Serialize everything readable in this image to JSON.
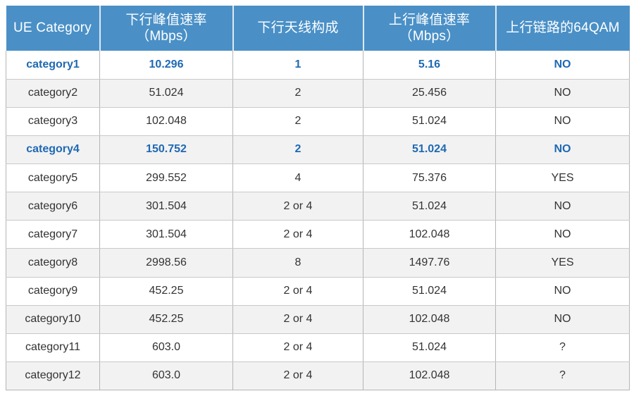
{
  "table": {
    "columns": [
      {
        "id": "ue_category",
        "lines": [
          "UE Category"
        ]
      },
      {
        "id": "dl_peak_rate",
        "lines": [
          "下行峰值速率",
          "（Mbps）"
        ]
      },
      {
        "id": "dl_antenna",
        "lines": [
          "下行天线构成"
        ]
      },
      {
        "id": "ul_peak_rate",
        "lines": [
          "上行峰值速率",
          "（Mbps）"
        ]
      },
      {
        "id": "ul_64qam",
        "lines": [
          "上行链路的64QAM"
        ]
      }
    ],
    "header_bg": "#4a90c7",
    "header_fg": "#ffffff",
    "highlight_color": "#1f69b3",
    "stripe_color": "#f2f2f2",
    "rows": [
      {
        "ue_category": "category1",
        "dl_peak_rate": "10.296",
        "dl_antenna": "1",
        "ul_peak_rate": "5.16",
        "ul_64qam": "NO",
        "highlight": true,
        "stripe": false
      },
      {
        "ue_category": "category2",
        "dl_peak_rate": "51.024",
        "dl_antenna": "2",
        "ul_peak_rate": "25.456",
        "ul_64qam": "NO",
        "highlight": false,
        "stripe": true
      },
      {
        "ue_category": "category3",
        "dl_peak_rate": "102.048",
        "dl_antenna": "2",
        "ul_peak_rate": "51.024",
        "ul_64qam": "NO",
        "highlight": false,
        "stripe": false
      },
      {
        "ue_category": "category4",
        "dl_peak_rate": "150.752",
        "dl_antenna": "2",
        "ul_peak_rate": "51.024",
        "ul_64qam": "NO",
        "highlight": true,
        "stripe": true
      },
      {
        "ue_category": "category5",
        "dl_peak_rate": "299.552",
        "dl_antenna": "4",
        "ul_peak_rate": "75.376",
        "ul_64qam": "YES",
        "highlight": false,
        "stripe": false
      },
      {
        "ue_category": "category6",
        "dl_peak_rate": "301.504",
        "dl_antenna": "2 or 4",
        "ul_peak_rate": "51.024",
        "ul_64qam": "NO",
        "highlight": false,
        "stripe": true
      },
      {
        "ue_category": "category7",
        "dl_peak_rate": "301.504",
        "dl_antenna": "2 or 4",
        "ul_peak_rate": "102.048",
        "ul_64qam": "NO",
        "highlight": false,
        "stripe": false
      },
      {
        "ue_category": "category8",
        "dl_peak_rate": "2998.56",
        "dl_antenna": "8",
        "ul_peak_rate": "1497.76",
        "ul_64qam": "YES",
        "highlight": false,
        "stripe": true
      },
      {
        "ue_category": "category9",
        "dl_peak_rate": "452.25",
        "dl_antenna": "2 or 4",
        "ul_peak_rate": "51.024",
        "ul_64qam": "NO",
        "highlight": false,
        "stripe": false
      },
      {
        "ue_category": "category10",
        "dl_peak_rate": "452.25",
        "dl_antenna": "2 or 4",
        "ul_peak_rate": "102.048",
        "ul_64qam": "NO",
        "highlight": false,
        "stripe": true
      },
      {
        "ue_category": "category11",
        "dl_peak_rate": "603.0",
        "dl_antenna": "2 or 4",
        "ul_peak_rate": "51.024",
        "ul_64qam": "?",
        "highlight": false,
        "stripe": false
      },
      {
        "ue_category": "category12",
        "dl_peak_rate": "603.0",
        "dl_antenna": "2 or 4",
        "ul_peak_rate": "102.048",
        "ul_64qam": "?",
        "highlight": false,
        "stripe": true
      }
    ]
  }
}
